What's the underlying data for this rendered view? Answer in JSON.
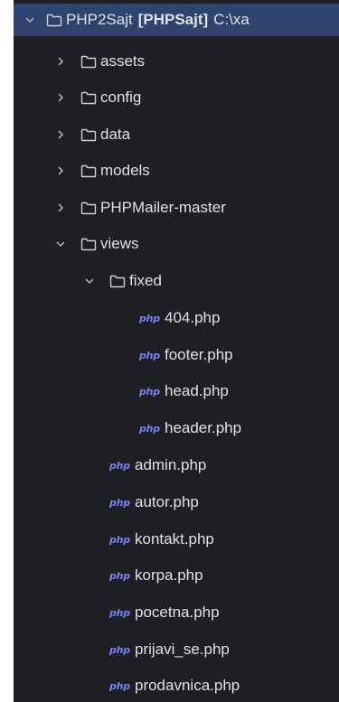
{
  "tree": {
    "root": {
      "name": "PHP2Sajt",
      "module": "[PHPSajt]",
      "path": "C:\\xa"
    },
    "folders": {
      "assets": "assets",
      "config": "config",
      "data": "data",
      "models": "models",
      "phpmailer": "PHPMailer-master",
      "views": "views",
      "fixed": "fixed"
    },
    "fixed_files": [
      "404.php",
      "footer.php",
      "head.php",
      "header.php"
    ],
    "view_files": [
      "admin.php",
      "autor.php",
      "kontakt.php",
      "korpa.php",
      "pocetna.php",
      "prijavi_se.php",
      "prodavnica.php"
    ],
    "file_icon": "php",
    "colors": {
      "background": "#1e1f22",
      "selected": "#2e436e",
      "php_icon": "#7b7ff7",
      "text": "#dfe1e5"
    }
  }
}
